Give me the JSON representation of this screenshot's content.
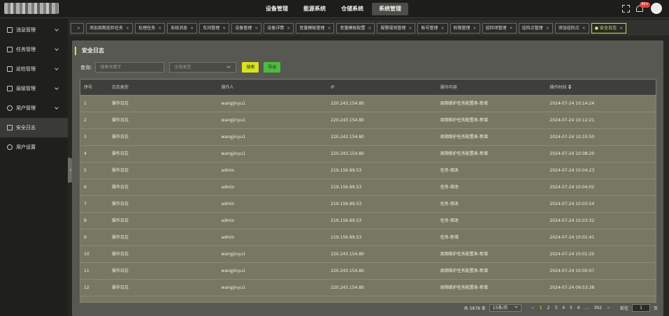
{
  "app": {
    "top_nav": [
      {
        "label": "设备管理",
        "active": false
      },
      {
        "label": "能源系统",
        "active": false
      },
      {
        "label": "仓储系统",
        "active": false
      },
      {
        "label": "系统管理",
        "active": true
      }
    ],
    "notification_badge": "99+"
  },
  "sidebar": {
    "items": [
      {
        "label": "消息管理",
        "icon": "message-icon"
      },
      {
        "label": "任务管理",
        "icon": "task-icon"
      },
      {
        "label": "巡检管理",
        "icon": "inspection-icon"
      },
      {
        "label": "层级管理",
        "icon": "hierarchy-icon"
      },
      {
        "label": "用户管理",
        "icon": "user-icon"
      },
      {
        "label": "安全日志",
        "icon": "log-icon",
        "active": true
      },
      {
        "label": "用户设置",
        "icon": "settings-icon"
      }
    ]
  },
  "tabs": [
    {
      "label": ""
    },
    {
      "label": "添加周期巡检任务"
    },
    {
      "label": "处理任务"
    },
    {
      "label": "系统消息"
    },
    {
      "label": "车间管理"
    },
    {
      "label": "设备管理"
    },
    {
      "label": "设备详情"
    },
    {
      "label": "变量模板管理"
    },
    {
      "label": "变量模板配置"
    },
    {
      "label": "报警规则管理"
    },
    {
      "label": "账号管理"
    },
    {
      "label": "权限管理"
    },
    {
      "label": "巡检项管理"
    },
    {
      "label": "巡检点管理"
    },
    {
      "label": "添加巡检点"
    },
    {
      "label": "安全日志",
      "active": true
    }
  ],
  "page": {
    "title": "安全日志",
    "query_label": "查询:",
    "search_placeholder": "搜索关键字",
    "type_select_value": "全部类型",
    "search_button": "搜索",
    "export_button": "导出"
  },
  "table": {
    "headers": [
      "序号",
      "日志类型",
      "操作人",
      "IP",
      "操作内容",
      "操作时间"
    ],
    "rows": [
      [
        "1",
        "操作日志",
        "wangjinyu1",
        "220.243.154.80",
        "周期维护任务配置表-新增",
        "2024-07-24 10:14:24"
      ],
      [
        "2",
        "操作日志",
        "wangjinyu1",
        "220.243.154.80",
        "周期维护任务配置表-新增",
        "2024-07-24 10:12:21"
      ],
      [
        "3",
        "操作日志",
        "wangjinyu1",
        "220.243.154.80",
        "周期维护任务配置表-新增",
        "2024-07-24 10:10:50"
      ],
      [
        "4",
        "操作日志",
        "wangjinyu1",
        "220.243.154.80",
        "周期维护任务配置表-新增",
        "2024-07-24 10:08:20"
      ],
      [
        "5",
        "操作日志",
        "admin",
        "219.156.89.53",
        "任务-修改",
        "2024-07-24 10:04:23"
      ],
      [
        "6",
        "操作日志",
        "admin",
        "219.156.89.53",
        "任务-修改",
        "2024-07-24 10:04:02"
      ],
      [
        "7",
        "操作日志",
        "admin",
        "219.156.89.53",
        "任务-修改",
        "2024-07-24 10:03:54"
      ],
      [
        "8",
        "操作日志",
        "admin",
        "219.156.89.53",
        "任务-修改",
        "2024-07-24 10:03:32"
      ],
      [
        "9",
        "操作日志",
        "admin",
        "219.156.89.53",
        "任务-新增",
        "2024-07-24 10:01:41"
      ],
      [
        "10",
        "操作日志",
        "wangjinyu1",
        "220.243.154.80",
        "周期维护任务配置表-新增",
        "2024-07-24 10:01:20"
      ],
      [
        "11",
        "操作日志",
        "wangjinyu1",
        "220.243.154.80",
        "周期维护任务配置表-新增",
        "2024-07-24 10:00:07"
      ],
      [
        "12",
        "操作日志",
        "wangjinyu1",
        "220.243.154.80",
        "周期维护任务配置表-新增",
        "2024-07-24 09:53:38"
      ]
    ]
  },
  "pagination": {
    "total": "共 5878 条",
    "page_size": "15条/页",
    "prev": "<",
    "pages": [
      "1",
      "2",
      "3",
      "4",
      "5",
      "6",
      "...",
      "392"
    ],
    "next": ">",
    "goto_label": "前往",
    "goto_value": "1",
    "page_suffix": "页"
  }
}
